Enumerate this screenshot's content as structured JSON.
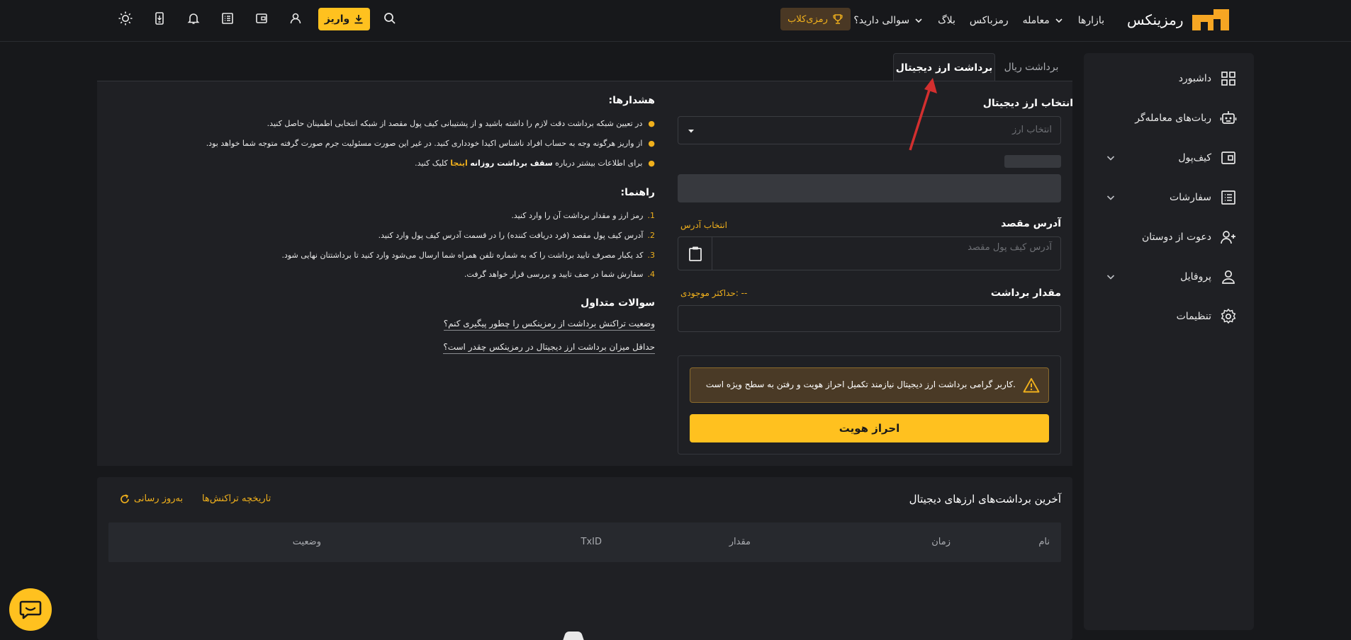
{
  "header": {
    "brand": "رمزینکس",
    "nav": [
      {
        "label": "بازارها",
        "chevron": false
      },
      {
        "label": "معامله",
        "chevron": true
      },
      {
        "label": "رمزباکس",
        "chevron": false
      },
      {
        "label": "بلاگ",
        "chevron": false
      },
      {
        "label": "سوالی دارید؟",
        "chevron": true
      }
    ],
    "club_label": "رمزی‌کلاب",
    "deposit_label": "واریز",
    "icons": [
      "search-icon",
      "download-icon",
      "user-icon",
      "wallet-icon",
      "orders-icon",
      "bell-icon",
      "mobile-app-icon",
      "theme-sun-icon"
    ]
  },
  "sidebar": {
    "items": [
      {
        "label": "داشبورد",
        "icon": "dashboard-icon",
        "chevron": false
      },
      {
        "label": "ربات‌های معامله‌گر",
        "icon": "robot-icon",
        "chevron": false
      },
      {
        "label": "کیف‌پول",
        "icon": "wallet-icon",
        "chevron": true
      },
      {
        "label": "سفارشات",
        "icon": "orders-icon",
        "chevron": true
      },
      {
        "label": "دعوت از دوستان",
        "icon": "invite-icon",
        "chevron": false
      },
      {
        "label": "پروفایل",
        "icon": "profile-icon",
        "chevron": true
      },
      {
        "label": "تنظیمات",
        "icon": "settings-icon",
        "chevron": false
      }
    ]
  },
  "tabs": {
    "active": "برداشت ارز دیجیتال",
    "inactive": "برداشت ریال"
  },
  "form": {
    "coin_label": "انتخاب ارز دیجیتال",
    "coin_placeholder": "انتخاب ارز",
    "address_label": "آدرس مقصد",
    "address_link": "انتخاب آدرس",
    "address_placeholder": "آدرس کیف پول مقصد",
    "amount_label": "مقدار برداشت",
    "max_balance": "حداکثر موجودی: --",
    "kyc_warning": "کاربر گرامی برداشت ارز دیجیتال نیازمند تکمیل احراز هویت و رفتن به سطح ویژه است.",
    "kyc_button": "احراز هویت"
  },
  "warnings": {
    "title": "هشدارها:",
    "items": [
      "در تعیین شبکه برداشت دقت لازم را داشته باشید و از پشتیبانی کیف پول مقصد از شبکه انتخابی اطمینان حاصل کنید.",
      "از واریز هرگونه وجه به حساب افراد ناشناس اکیدا خودداری کنید. در غیر این صورت مسئولیت جرم صورت گرفته متوجه شما خواهد بود."
    ],
    "limit_prefix": "برای اطلاعات بیشتر درباره",
    "limit_bold": "سقف برداشت روزانه",
    "limit_link": "اینجا",
    "limit_suffix": "کلیک کنید."
  },
  "guide": {
    "title": "راهنما:",
    "steps": [
      {
        "num": "1.",
        "text": "رمز ارز و مقدار برداشت آن را وارد کنید."
      },
      {
        "num": "2.",
        "text": "آدرس کیف پول مقصد (فرد دریافت کننده) را در قسمت آدرس کیف پول وارد کنید."
      },
      {
        "num": "3.",
        "text": "کد یکبار مصرف تایید برداشت را که به شماره تلفن همراه شما ارسال می‌شود وارد کنید تا برداشتتان نهایی شود."
      },
      {
        "num": "4.",
        "text": "سفارش شما در صف تایید و بررسی قرار خواهد گرفت."
      }
    ]
  },
  "faq": {
    "title": "سوالات متداول",
    "items": [
      "وضعیت تراکنش برداشت از رمزینکس را چطور پیگیری کنم؟",
      "حداقل میزان برداشت ارز دیجیتال در رمزینکس چقدر است؟"
    ]
  },
  "history": {
    "title": "آخرین برداشت‌های ارزهای دیجیتال",
    "tx_history_link": "تاریخچه تراکنش‌ها",
    "refresh_label": "به‌روز رسانی",
    "columns": [
      "نام",
      "زمان",
      "مقدار",
      "TxID",
      "وضعیت"
    ]
  },
  "colors": {
    "accent": "#ffc11f",
    "accent_text": "#f0b01c",
    "background": "#17181b",
    "card": "#1f2024",
    "annotation_arrow": "#d32f2f"
  }
}
